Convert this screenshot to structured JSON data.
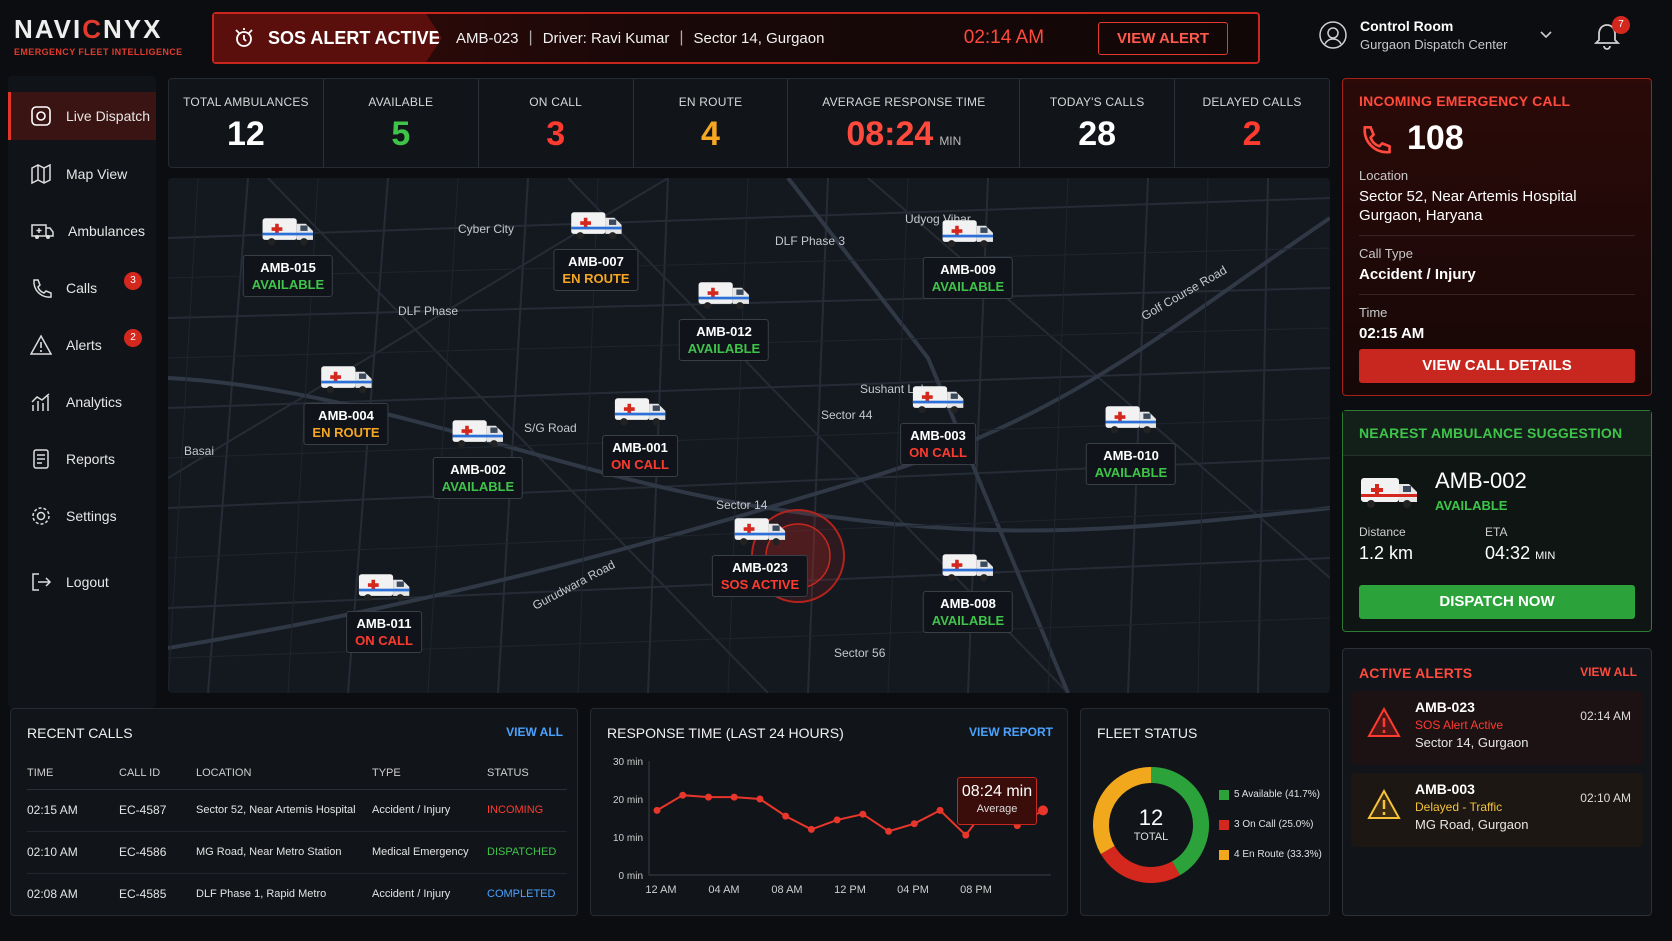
{
  "header": {
    "logo_pre": "NAVI",
    "logo_mid": "C",
    "logo_post": "NYX",
    "tagline": "EMERGENCY FLEET INTELLIGENCE",
    "sos": {
      "title": "SOS ALERT ACTIVE",
      "unit": "AMB-023",
      "driver": "Driver: Ravi Kumar",
      "location": "Sector 14, Gurgaon",
      "time": "02:14 AM",
      "button": "VIEW ALERT"
    },
    "control": {
      "title": "Control Room",
      "subtitle": "Gurgaon Dispatch Center"
    },
    "notifications": "7"
  },
  "sidebar": {
    "items": [
      {
        "label": "Live Dispatch",
        "icon": "dispatch-icon"
      },
      {
        "label": "Map View",
        "icon": "map-icon"
      },
      {
        "label": "Ambulances",
        "icon": "ambulance-icon"
      },
      {
        "label": "Calls",
        "icon": "phone-icon",
        "badge": "3"
      },
      {
        "label": "Alerts",
        "icon": "warning-icon",
        "badge": "2"
      },
      {
        "label": "Analytics",
        "icon": "analytics-icon"
      },
      {
        "label": "Reports",
        "icon": "reports-icon"
      },
      {
        "label": "Settings",
        "icon": "gear-icon"
      },
      {
        "label": "Logout",
        "icon": "logout-icon"
      }
    ]
  },
  "stats": [
    {
      "label": "TOTAL AMBULANCES",
      "value": "12",
      "color": "#ffffff"
    },
    {
      "label": "AVAILABLE",
      "value": "5",
      "color": "#3fc44a"
    },
    {
      "label": "ON CALL",
      "value": "3",
      "color": "#ff3b30"
    },
    {
      "label": "EN ROUTE",
      "value": "4",
      "color": "#f5a623"
    },
    {
      "label": "AVERAGE RESPONSE TIME",
      "value": "08:24",
      "unit": "MIN",
      "color": "#ff4a3d"
    },
    {
      "label": "TODAY'S CALLS",
      "value": "28",
      "color": "#ffffff"
    },
    {
      "label": "DELAYED CALLS",
      "value": "2",
      "color": "#ff3b30"
    }
  ],
  "map": {
    "labels": [
      "Cyber City",
      "DLF Phase 3",
      "Udyog Vihar",
      "DLF Phase",
      "Golf Course Road",
      "Sushant Lok",
      "Sector 44",
      "S/G Road",
      "Basai",
      "Sector 14",
      "Sector 56",
      "Gurudwara Road"
    ],
    "units": [
      {
        "id": "AMB-015",
        "status": "AVAILABLE",
        "cls": "st-available"
      },
      {
        "id": "AMB-007",
        "status": "EN ROUTE",
        "cls": "st-enroute"
      },
      {
        "id": "AMB-009",
        "status": "AVAILABLE",
        "cls": "st-available"
      },
      {
        "id": "AMB-012",
        "status": "AVAILABLE",
        "cls": "st-available"
      },
      {
        "id": "AMB-004",
        "status": "EN ROUTE",
        "cls": "st-enroute"
      },
      {
        "id": "AMB-001",
        "status": "ON CALL",
        "cls": "st-oncall"
      },
      {
        "id": "AMB-003",
        "status": "ON CALL",
        "cls": "st-oncall"
      },
      {
        "id": "AMB-002",
        "status": "AVAILABLE",
        "cls": "st-available"
      },
      {
        "id": "AMB-010",
        "status": "AVAILABLE",
        "cls": "st-available"
      },
      {
        "id": "AMB-023",
        "status": "SOS ACTIVE",
        "cls": "st-oncall"
      },
      {
        "id": "AMB-008",
        "status": "AVAILABLE",
        "cls": "st-available"
      },
      {
        "id": "AMB-011",
        "status": "ON CALL",
        "cls": "st-oncall"
      }
    ]
  },
  "incoming": {
    "title": "INCOMING EMERGENCY CALL",
    "number": "108",
    "location_label": "Location",
    "location_line1": "Sector 52, Near Artemis Hospital",
    "location_line2": "Gurgaon, Haryana",
    "type_label": "Call Type",
    "type": "Accident / Injury",
    "time_label": "Time",
    "time": "02:15 AM",
    "button": "VIEW CALL DETAILS"
  },
  "nearest": {
    "title": "NEAREST AMBULANCE SUGGESTION",
    "unit": "AMB-002",
    "status": "AVAILABLE",
    "distance_label": "Distance",
    "distance": "1.2 km",
    "eta_label": "ETA",
    "eta": "04:32",
    "eta_unit": "MIN",
    "button": "DISPATCH NOW"
  },
  "alerts": {
    "title": "ACTIVE ALERTS",
    "link": "VIEW ALL",
    "items": [
      {
        "unit": "AMB-023",
        "status": "SOS Alert Active",
        "location": "Sector 14, Gurgaon",
        "time": "02:14 AM"
      },
      {
        "unit": "AMB-003",
        "status": "Delayed - Traffic",
        "location": "MG Road, Gurgaon",
        "time": "02:10 AM"
      }
    ]
  },
  "recent_calls": {
    "title": "RECENT CALLS",
    "link": "VIEW ALL",
    "columns": [
      "TIME",
      "CALL ID",
      "LOCATION",
      "TYPE",
      "STATUS"
    ],
    "rows": [
      [
        "02:15 AM",
        "EC-4587",
        "Sector 52, Near Artemis Hospital",
        "Accident / Injury",
        "INCOMING"
      ],
      [
        "02:10 AM",
        "EC-4586",
        "MG Road, Near Metro Station",
        "Medical Emergency",
        "DISPATCHED"
      ],
      [
        "02:08 AM",
        "EC-4585",
        "DLF Phase 1, Rapid Metro",
        "Accident / Injury",
        "COMPLETED"
      ]
    ]
  },
  "response_time": {
    "title": "RESPONSE TIME (LAST 24 HOURS)",
    "link": "VIEW REPORT",
    "callout_value": "08:24 min",
    "callout_label": "Average",
    "chart_data": {
      "type": "line",
      "y_ticks": [
        "30 min",
        "20 min",
        "10 min",
        "0 min"
      ],
      "x_ticks": [
        "12 AM",
        "04 AM",
        "08 AM",
        "12 PM",
        "04 PM",
        "08 PM"
      ],
      "ylim": [
        0,
        30
      ],
      "x": [
        0,
        1,
        2,
        3,
        4,
        5,
        6,
        7,
        8,
        9,
        10,
        11,
        12,
        13,
        14,
        15
      ],
      "values": [
        17,
        21,
        20.5,
        20.5,
        20,
        15.5,
        12,
        14.5,
        16,
        11.5,
        13.5,
        17,
        10.5,
        19.5,
        13,
        17
      ]
    }
  },
  "fleet": {
    "title": "FLEET STATUS",
    "total": "12",
    "total_label": "TOTAL",
    "chart_data": {
      "type": "pie",
      "slices": [
        {
          "label": "5 Available (41.7%)",
          "value": 5,
          "color": "#2ba33a"
        },
        {
          "label": "3 On Call (25.0%)",
          "value": 3,
          "color": "#d4281f"
        },
        {
          "label": "4 En Route (33.3%)",
          "value": 4,
          "color": "#f2a81d"
        }
      ]
    }
  },
  "colors": {
    "accent": "#e23b2e",
    "available": "#3fc44a",
    "oncall": "#ff3b30",
    "enroute": "#f5a623",
    "link": "#4aa3ff"
  }
}
